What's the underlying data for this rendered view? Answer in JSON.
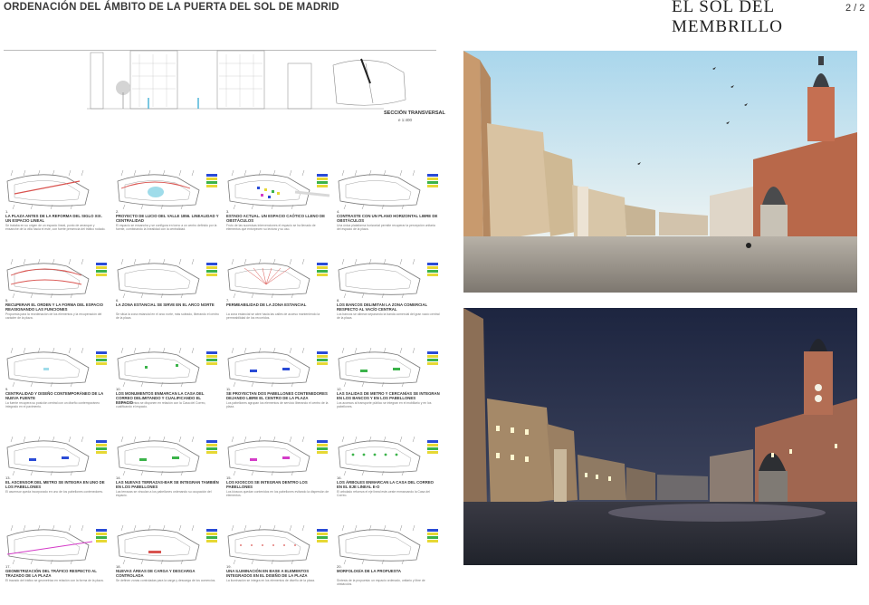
{
  "header": {
    "title": "ORDENACIÓN DEL ÁMBITO DE LA PUERTA DEL SOL DE MADRID",
    "brand": "EL SOL DEL MEMBRILLO",
    "page": "2 / 2"
  },
  "elevation": {
    "section_label": "SECCIÓN TRANSVERSAL",
    "scale": "e 1:400"
  },
  "panels": [
    {
      "number": "1.",
      "title": "LA PLAZA ANTES DE LA REFORMA DEL SIGLO XIX. UN ESPACIO LINEAL",
      "desc": "Se trataba en su origen de un espacio lineal, punto de arranque y ensanche de la villa hacia el este, con fuerte presencia del tráfico rodado."
    },
    {
      "number": "2.",
      "title": "PROYECTO DE LUCIO DEL VALLE 1856. LINEALIDAD Y CENTRALIDAD",
      "desc": "El espacio se ensancha y se configura en torno a un centro definido por la fuente, combinando la linealidad con la centralidad."
    },
    {
      "number": "3.",
      "title": "ESTADO ACTUAL. UN ESPACIO CAÓTICO LLENO DE OBSTÁCULOS",
      "desc": "Fruto de las sucesivas intervenciones el espacio se ha llenado de elementos que entorpecen su lectura y su uso."
    },
    {
      "number": "4.",
      "title": "CONTRASTE CON UN PLANO HORIZONTAL LIBRE DE OBSTÁCULOS",
      "desc": "Una única plataforma horizontal permite recuperar la percepción unitaria del espacio de la plaza."
    },
    {
      "number": "5.",
      "title": "RECUPERAR EL ORDEN Y LA FORMA DEL ESPACIO REASIGNANDO LAS FUNCIONES",
      "desc": "Propuesta para la reordenación de los elementos y la recuperación del carácter de la plaza."
    },
    {
      "number": "6.",
      "title": "LA ZONA ESTANCIAL SE SIRVE EN EL ARCO NORTE",
      "desc": "Se sitúa la zona estancial en el arco norte, más soleado, liberando el centro de la plaza."
    },
    {
      "number": "7.",
      "title": "PERMEABILIDAD DE LA ZONA ESTANCIAL",
      "desc": "La zona estancial se abre hacia las calles de acceso manteniendo la permeabilidad de los recorridos."
    },
    {
      "number": "8.",
      "title": "LOS BANCOS DELIMITAN LA ZONA COMERCIAL RESPECTO AL VACÍO CENTRAL",
      "desc": "Los bancos se alinean separando la banda comercial del gran vacío central de la plaza."
    },
    {
      "number": "9.",
      "title": "CENTRALIDAD Y DISEÑO CONTEMPORÁNEO DE LA NUEVA FUENTE",
      "desc": "La fuente recupera su posición central con un diseño contemporáneo integrado en el pavimento."
    },
    {
      "number": "10.",
      "title": "LOS MONUMENTOS ENMARCAN LA CASA DEL CORREO DELIMITANDO Y CUALIFICANDO EL ESPACIO",
      "desc": "Los monumentos se disponen en relación con la Casa del Correo, cualificando el espacio."
    },
    {
      "number": "11.",
      "title": "SE PROYECTAN DOS PABELLONES CONTENEDORES DEJANDO LIBRE EL CENTRO DE LA PLAZA",
      "desc": "Los pabellones agrupan los elementos de servicio liberando el centro de la plaza."
    },
    {
      "number": "12.",
      "title": "LAS SALIDAS DE METRO Y CERCANÍAS SE INTEGRAN EN LOS BANCOS Y EN LOS PABELLONES",
      "desc": "Los accesos al transporte público se integran en el mobiliario y en los pabellones."
    },
    {
      "number": "13.",
      "title": "EL ASCENSOR DEL METRO SE INTEGRA EN UNO DE LOS PABELLONES",
      "desc": "El ascensor queda incorporado en uno de los pabellones contenedores."
    },
    {
      "number": "14.",
      "title": "LAS NUEVAS TERRAZAS-BAR SE INTEGRAN TAMBIÉN EN LOS PABELLONES",
      "desc": "Las terrazas se vinculan a los pabellones ordenando su ocupación del espacio."
    },
    {
      "number": "15.",
      "title": "LOS KIOSCOS SE INTEGRAN DENTRO LOS PABELLONES",
      "desc": "Los kioscos quedan contenidos en los pabellones evitando la dispersión de elementos."
    },
    {
      "number": "16.",
      "title": "LOS ÁRBOLES ENMARCAN LA CASA DEL CORREO EN EL EJE LINEAL E-O",
      "desc": "El arbolado refuerza el eje lineal este-oeste enmarcando la Casa del Correo."
    },
    {
      "number": "17.",
      "title": "GEOMETRIZACIÓN DEL TRÁFICO RESPECTO AL TRAZADO DE LA PLAZA",
      "desc": "El trazado del tráfico se geometriza en relación con la forma de la plaza."
    },
    {
      "number": "18.",
      "title": "NUEVAS ÁREAS DE CARGA Y DESCARGA CONTROLADA",
      "desc": "Se definen zonas controladas para la carga y descarga de los comercios."
    },
    {
      "number": "19.",
      "title": "UNA ILUMINACIÓN EN BASE A ELEMENTOS INTEGRADOS EN EL DISEÑO DE LA PLAZA",
      "desc": "La iluminación se integra en los elementos de diseño de la plaza."
    },
    {
      "number": "20.",
      "title": "MORFOLOGÍA DE LA PROPUESTA",
      "desc": "Síntesis de la propuesta: un espacio ordenado, unitario y libre de obstáculos."
    }
  ],
  "colors": {
    "accent_red": "#d9534f",
    "accent_cyan": "#9fdcea",
    "legend_blue": "#2a4bd6",
    "legend_yellow": "#e7d834",
    "legend_green": "#3bb34a",
    "legend_magenta": "#d43cc8"
  }
}
